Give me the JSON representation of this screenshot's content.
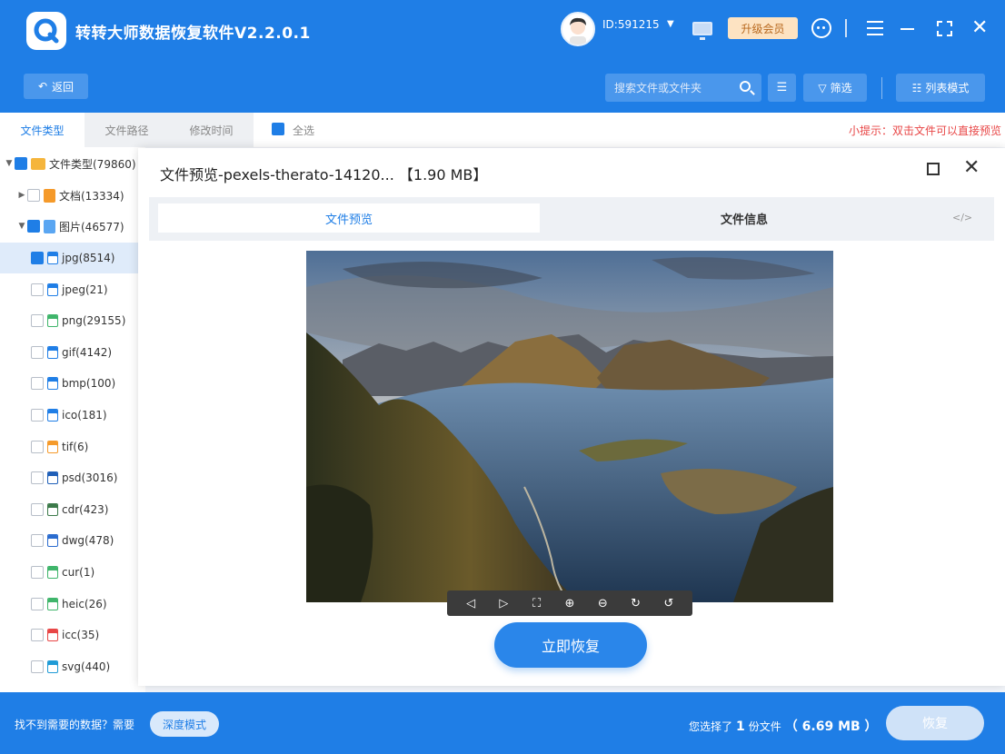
{
  "app": {
    "title": "转转大师数据恢复软件V2.2.0.1",
    "user_id": "ID:591215",
    "vip_label": "升级会员"
  },
  "toolbar": {
    "back_label": "返回",
    "search_placeholder": "搜索文件或文件夹",
    "filter_label": "筛选",
    "list_mode_label": "列表模式"
  },
  "tabs": [
    {
      "label": "文件类型"
    },
    {
      "label": "文件路径"
    },
    {
      "label": "修改时间"
    }
  ],
  "select_all_label": "全选",
  "tip": "小提示：双击文件可以直接预览",
  "tree": {
    "root": "文件类型(79860)",
    "doc": "文档(13334)",
    "pic": "图片(46577)",
    "items": [
      {
        "label": "jpg(8514)",
        "color": "#1f7ee6"
      },
      {
        "label": "jpeg(21)",
        "color": "#1f7ee6"
      },
      {
        "label": "png(29155)",
        "color": "#3fb56b"
      },
      {
        "label": "gif(4142)",
        "color": "#1f7ee6"
      },
      {
        "label": "bmp(100)",
        "color": "#1f7ee6"
      },
      {
        "label": "ico(181)",
        "color": "#1f7ee6"
      },
      {
        "label": "tif(6)",
        "color": "#f59a2a"
      },
      {
        "label": "psd(3016)",
        "color": "#1f5fb8"
      },
      {
        "label": "cdr(423)",
        "color": "#3c7a4a"
      },
      {
        "label": "dwg(478)",
        "color": "#2b6ccf"
      },
      {
        "label": "cur(1)",
        "color": "#3fb56b"
      },
      {
        "label": "heic(26)",
        "color": "#3fb56b"
      },
      {
        "label": "icc(35)",
        "color": "#e84646"
      },
      {
        "label": "svg(440)",
        "color": "#1f9bd6"
      }
    ]
  },
  "modal": {
    "title": "文件预览-pexels-therato-14120...  【1.90 MB】",
    "tab_preview": "文件预览",
    "tab_info": "文件信息",
    "code_toggle": "</>",
    "recover_now": "立即恢复"
  },
  "bottom": {
    "question": "找不到需要的数据？需要",
    "deep_mode": "深度模式",
    "selected_prefix": "您选择了",
    "selected_count": "1",
    "selected_unit": "份文件",
    "selected_size": "（ 6.69 MB ）",
    "recover": "恢复"
  },
  "colors": {
    "brand": "#1f7ee6",
    "tip_red": "#e84646",
    "vip_bg": "#fde3c2"
  }
}
